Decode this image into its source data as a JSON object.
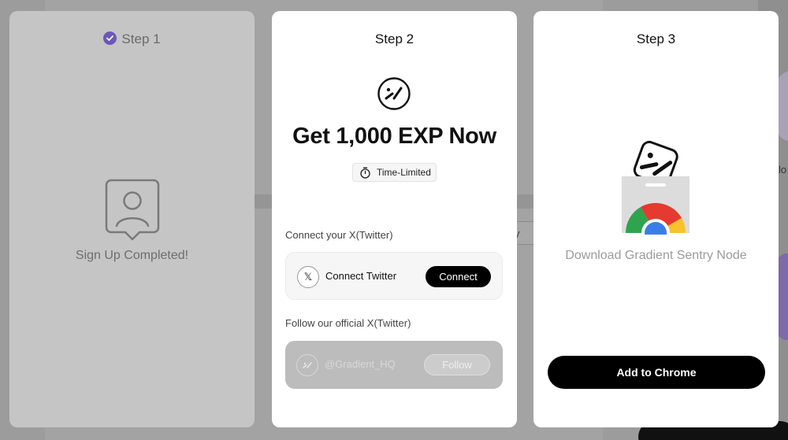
{
  "background": {
    "dropdown_text": "y",
    "right_text": "lo"
  },
  "step1": {
    "title": "Step 1",
    "status": "Sign Up Completed!",
    "icons": {
      "check": "check-circle-icon",
      "profile": "user-profile-icon"
    }
  },
  "step2": {
    "title": "Step 2",
    "headline": "Get 1,000 EXP Now",
    "badge": "Time-Limited",
    "connect_section": "Connect your X(Twitter)",
    "connect_label": "Connect Twitter",
    "connect_button": "Connect",
    "follow_section": "Follow our official X(Twitter)",
    "follow_handle": "@Gradient_HQ",
    "follow_button": "Follow",
    "x_glyph": "𝕏",
    "icons": {
      "logo": "gradient-logo-icon",
      "timer": "stopwatch-icon"
    }
  },
  "step3": {
    "title": "Step 3",
    "description": "Download Gradient Sentry Node",
    "button": "Add to Chrome",
    "icons": {
      "art": "chrome-extension-icon"
    }
  },
  "colors": {
    "accent": "#6b58b8",
    "overlay": "#9c9c9c",
    "card": "#ffffff",
    "completed_card": "#c5c5c5",
    "primary_button": "#000000"
  }
}
